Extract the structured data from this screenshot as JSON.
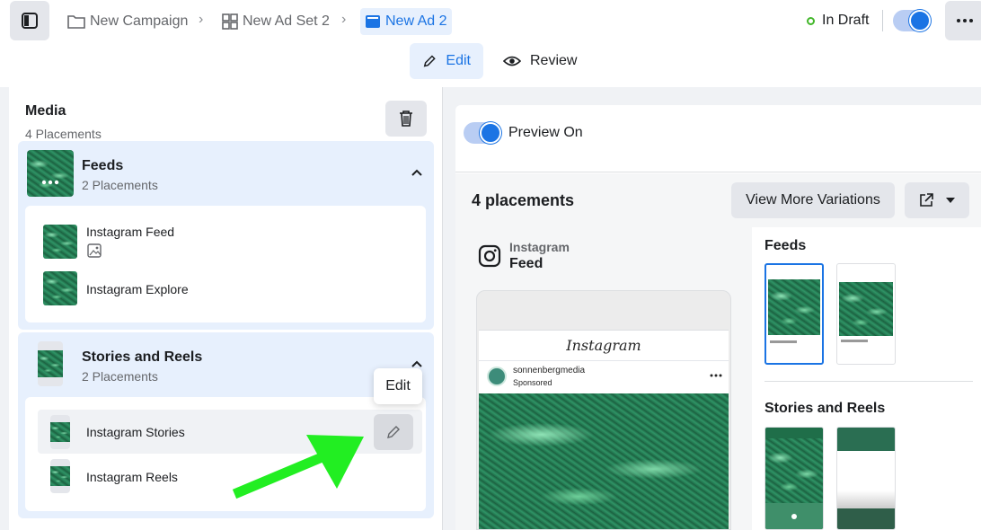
{
  "topbar": {
    "breadcrumb": [
      {
        "label": "New Campaign"
      },
      {
        "label": "New Ad Set 2"
      },
      {
        "label": "New Ad 2"
      }
    ],
    "status": "In Draft",
    "toggle_on": true
  },
  "modes": {
    "edit": "Edit",
    "review": "Review"
  },
  "media": {
    "title": "Media",
    "subtitle": "4 Placements",
    "groups": [
      {
        "title": "Feeds",
        "subtitle": "2 Placements",
        "items": [
          "Instagram Feed",
          "Instagram Explore"
        ]
      },
      {
        "title": "Stories and Reels",
        "subtitle": "2 Placements",
        "items": [
          "Instagram Stories",
          "Instagram Reels"
        ]
      }
    ],
    "edit_tooltip": "Edit"
  },
  "preview": {
    "toggle_label": "Preview On",
    "count_label": "4 placements",
    "variations_button": "View More Variations",
    "platform": "Instagram",
    "placement": "Feed",
    "ig_wordmark": "Instagram",
    "account": "sonnenbergmedia",
    "sponsored": "Sponsored",
    "sections": {
      "feeds": "Feeds",
      "stories": "Stories and Reels"
    }
  },
  "colors": {
    "accent": "#1b74e4",
    "status_green": "#42b72a",
    "arrow": "#22ee22"
  }
}
